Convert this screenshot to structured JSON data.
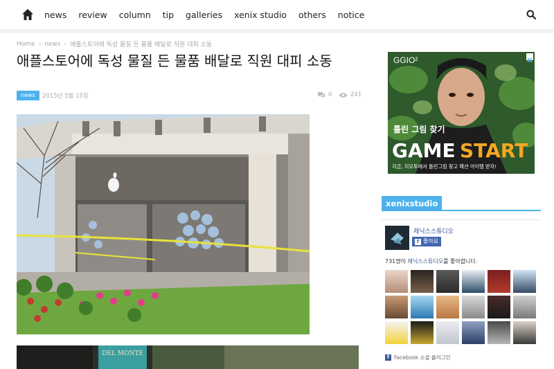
{
  "nav": {
    "items": [
      "news",
      "review",
      "column",
      "tip",
      "galleries",
      "xenix studio",
      "others",
      "notice"
    ]
  },
  "breadcrumb": {
    "home": "Home",
    "category": "news",
    "current": "애플스토어에 독성 물질 든 물품 배달로 직원 대피 소동"
  },
  "article": {
    "title": "애플스토어에 독성 물질 든 물품 배달로 직원 대피 소동",
    "category_tag": "news",
    "date": "2015년 5월 15일",
    "comments": "0",
    "views": "241"
  },
  "photo2": {
    "sign_text": "DEL MONTE"
  },
  "ad": {
    "brand": "GGIO²",
    "tagline": "틀린 그림 찾기",
    "headline_1": "GAME",
    "headline_2": "START",
    "subtext": "지금, 지오투에서 틀린그림 찾고 패션 아이템 받자!"
  },
  "widget": {
    "title": "xenixstudio",
    "page_name": "제닉스스튜디오",
    "like_label": "좋아요",
    "count_text": "731명이",
    "count_page": "제닉스스튜디오",
    "count_suffix": "를 좋아합니다.",
    "footer": "Facebook 소셜 플러그인"
  },
  "colors": {
    "accent": "#4db2ec",
    "facebook": "#3b5998"
  }
}
